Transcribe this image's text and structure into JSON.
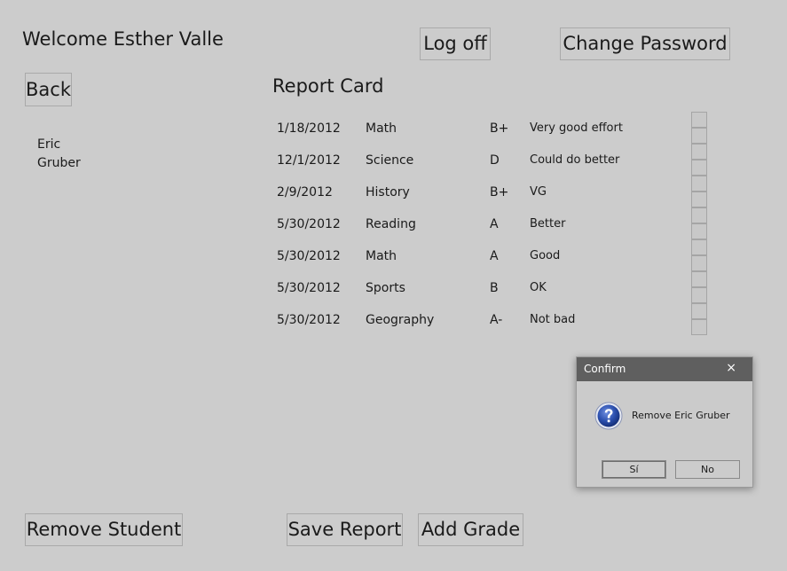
{
  "header": {
    "welcome": "Welcome Esther Valle",
    "logoff_label": "Log off",
    "change_password_label": "Change Password"
  },
  "nav": {
    "back_label": "Back"
  },
  "student": {
    "first": "Eric",
    "last": "Gruber"
  },
  "report": {
    "title": "Report Card",
    "rows": [
      {
        "date": "1/18/2012",
        "subject": "Math",
        "grade": "B+",
        "comment": "Very good effort"
      },
      {
        "date": "12/1/2012",
        "subject": "Science",
        "grade": "D",
        "comment": "Could do better"
      },
      {
        "date": "2/9/2012",
        "subject": "History",
        "grade": "B+",
        "comment": "VG"
      },
      {
        "date": "5/30/2012",
        "subject": "Reading",
        "grade": "A",
        "comment": "Better"
      },
      {
        "date": "5/30/2012",
        "subject": "Math",
        "grade": "A",
        "comment": "Good"
      },
      {
        "date": "5/30/2012",
        "subject": "Sports",
        "grade": "B",
        "comment": "OK"
      },
      {
        "date": "5/30/2012",
        "subject": "Geography",
        "grade": "A-",
        "comment": "Not bad"
      }
    ]
  },
  "actions": {
    "remove_student_label": "Remove Student",
    "save_report_label": "Save Report",
    "add_grade_label": "Add Grade"
  },
  "dialog": {
    "title": "Confirm",
    "close_glyph": "×",
    "icon": "question-icon",
    "message": "Remove Eric Gruber",
    "yes_label": "Sí",
    "no_label": "No"
  },
  "colors": {
    "background": "#cccccc",
    "dialog_titlebar": "#5f5f5f",
    "question_icon_blue": "#2b4fae"
  }
}
